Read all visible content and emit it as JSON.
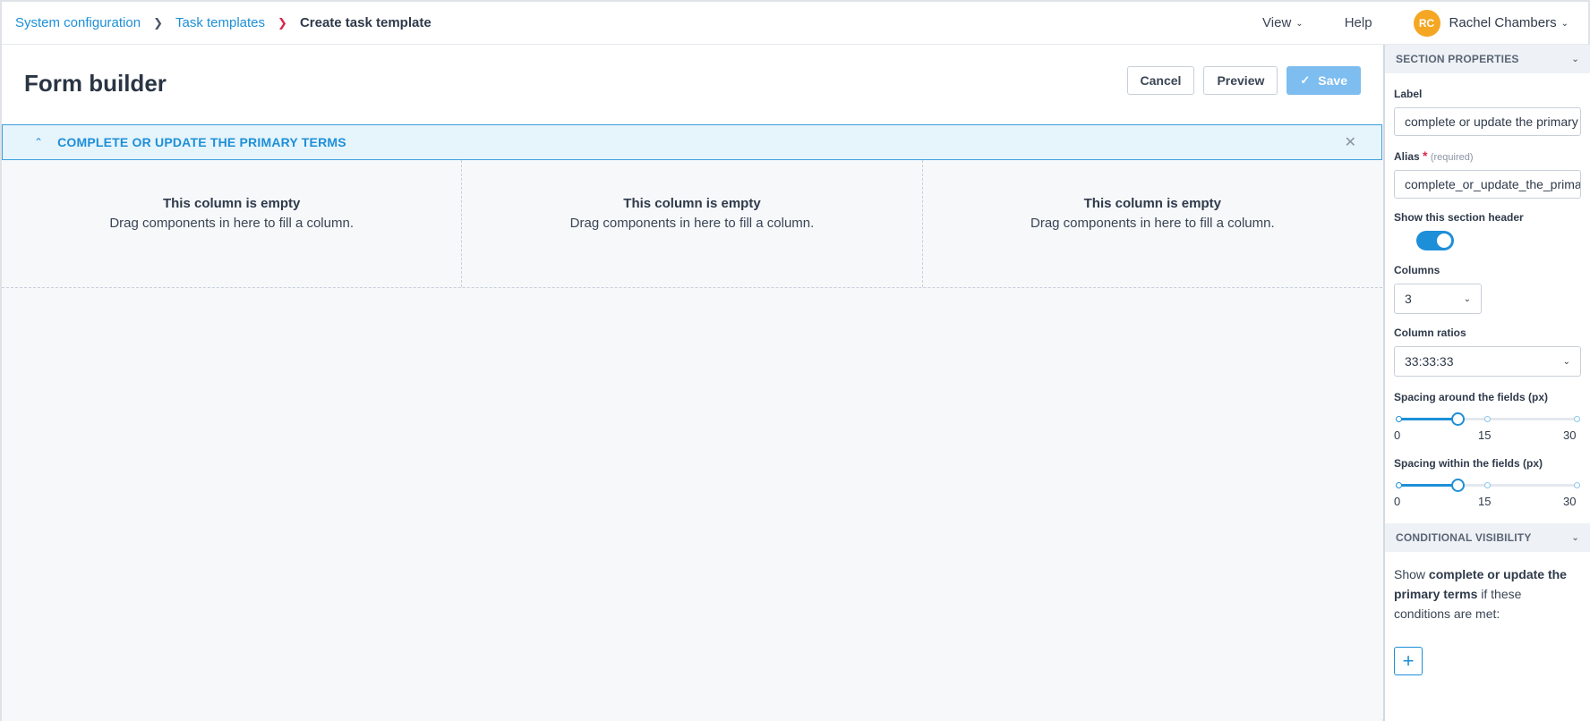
{
  "breadcrumb": {
    "items": [
      "System configuration",
      "Task templates"
    ],
    "current": "Create task template"
  },
  "topnav": {
    "view_label": "View",
    "help_label": "Help",
    "user_initials": "RC",
    "user_name": "Rachel Chambers"
  },
  "page": {
    "title": "Form builder",
    "cancel_label": "Cancel",
    "preview_label": "Preview",
    "save_label": "Save"
  },
  "section": {
    "title": "COMPLETE OR UPDATE THE PRIMARY TERMS",
    "columns": [
      {
        "title": "This column is empty",
        "hint": "Drag components in here to fill a column."
      },
      {
        "title": "This column is empty",
        "hint": "Drag components in here to fill a column."
      },
      {
        "title": "This column is empty",
        "hint": "Drag components in here to fill a column."
      }
    ]
  },
  "panel": {
    "props_header": "SECTION PROPERTIES",
    "label_label": "Label",
    "label_value": "complete or update the primary terms",
    "alias_label": "Alias",
    "alias_required_mark": "*",
    "alias_hint": "(required)",
    "alias_value": "complete_or_update_the_primary_terms",
    "show_header_label": "Show this section header",
    "show_header_on": true,
    "columns_label": "Columns",
    "columns_value": "3",
    "ratios_label": "Column ratios",
    "ratios_value": "33:33:33",
    "spacing_around_label": "Spacing around the fields (px)",
    "spacing_around_value": 10,
    "spacing_within_label": "Spacing within the fields (px)",
    "spacing_within_value": 10,
    "slider_ticks": [
      "0",
      "15",
      "30"
    ],
    "slider_max": 30,
    "cond_header": "CONDITIONAL VISIBILITY",
    "cond_prefix": "Show ",
    "cond_bold": "complete or update the primary terms",
    "cond_suffix": " if these conditions are met:",
    "add_label": "+"
  },
  "colors": {
    "accent": "#1d8fd8",
    "save_button": "#7dbdf0",
    "avatar": "#f5a623",
    "breadcrumb_separator_active": "#d9264a"
  }
}
